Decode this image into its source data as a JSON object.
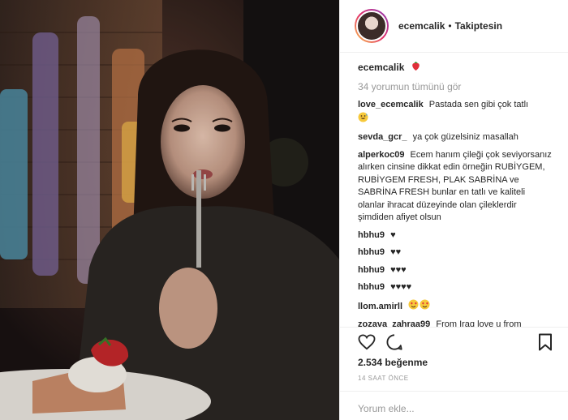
{
  "post": {
    "username": "ecemcalik",
    "separator": "•",
    "follow_label": "Takiptesin",
    "caption_username": "ecemcalik",
    "caption_emoji": "strawberry-emoji",
    "view_all_comments": "34 yorumun tümünü gör",
    "likes": "2.534 beğenme",
    "time_ago": "14 SAAT ÖNCE",
    "add_comment_placeholder": "Yorum ekle..."
  },
  "comments": [
    {
      "user": "love_ecemcalik",
      "text": "Pastada sen gibi çok tatlı",
      "emoji": "grin-sweat-emoji"
    },
    {
      "user": "sevda_gcr_",
      "text": "ya çok güzelsiniz masallah"
    },
    {
      "user": "alperkoc09",
      "text": "Ecem hanım çileği çok seviyorsanız alırken cinsine dikkat edin örneğin RUBİYGEM, RUBİYGEM FRESH, PLAK SABRİNA ve SABRİNA FRESH bunlar en tatlı ve kaliteli olanlar ihracat düzeyinde olan çileklerdir şimdiden afiyet olsun"
    },
    {
      "user": "hbhu9",
      "text": "♥"
    },
    {
      "user": "hbhu9",
      "text": "♥♥"
    },
    {
      "user": "hbhu9",
      "text": "♥♥♥"
    },
    {
      "user": "hbhu9",
      "text": "♥♥♥♥"
    },
    {
      "user": "llom.amirll",
      "text": "",
      "emoji": "heart-eyes-emoji x2"
    },
    {
      "user": "zozava_zahraa99",
      "text": "From Iraq love u from"
    }
  ],
  "colors": {
    "text": "#262626",
    "muted": "#999999",
    "border": "#efefef"
  }
}
